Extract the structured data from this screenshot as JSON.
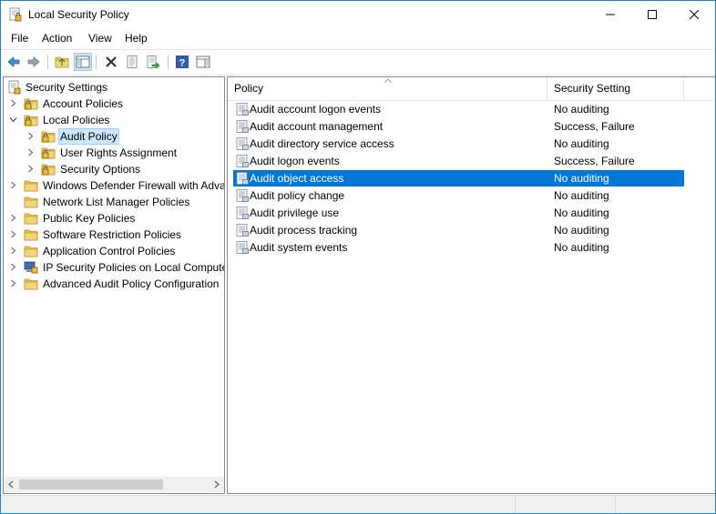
{
  "window": {
    "title": "Local Security Policy"
  },
  "menu": [
    "File",
    "Action",
    "View",
    "Help"
  ],
  "toolbar": {
    "buttons": [
      "back-icon",
      "forward-icon",
      "up-one-level-icon",
      "show-hide-console-tree-icon",
      "delete-icon",
      "properties-icon",
      "export-list-icon",
      "help-icon",
      "show-hide-action-pane-icon"
    ]
  },
  "tree": {
    "root": "Security Settings",
    "items": [
      {
        "label": "Account Policies"
      },
      {
        "label": "Local Policies"
      },
      {
        "label": "Audit Policy"
      },
      {
        "label": "User Rights Assignment"
      },
      {
        "label": "Security Options"
      },
      {
        "label": "Windows Defender Firewall with Adva"
      },
      {
        "label": "Network List Manager Policies"
      },
      {
        "label": "Public Key Policies"
      },
      {
        "label": "Software Restriction Policies"
      },
      {
        "label": "Application Control Policies"
      },
      {
        "label": "IP Security Policies on Local Compute"
      },
      {
        "label": "Advanced Audit Policy Configuration"
      }
    ]
  },
  "list": {
    "columns": [
      "Policy",
      "Security Setting"
    ],
    "rows": [
      {
        "policy": "Audit account logon events",
        "setting": "No auditing"
      },
      {
        "policy": "Audit account management",
        "setting": "Success, Failure"
      },
      {
        "policy": "Audit directory service access",
        "setting": "No auditing"
      },
      {
        "policy": "Audit logon events",
        "setting": "Success, Failure"
      },
      {
        "policy": "Audit object access",
        "setting": "No auditing"
      },
      {
        "policy": "Audit policy change",
        "setting": "No auditing"
      },
      {
        "policy": "Audit privilege use",
        "setting": "No auditing"
      },
      {
        "policy": "Audit process tracking",
        "setting": "No auditing"
      },
      {
        "policy": "Audit system events",
        "setting": "No auditing"
      }
    ],
    "selected_row": "Audit object access"
  },
  "colors": {
    "selection": "#0078d7",
    "tree_selection": "#cce8ff",
    "window_border": "#1883d7"
  }
}
